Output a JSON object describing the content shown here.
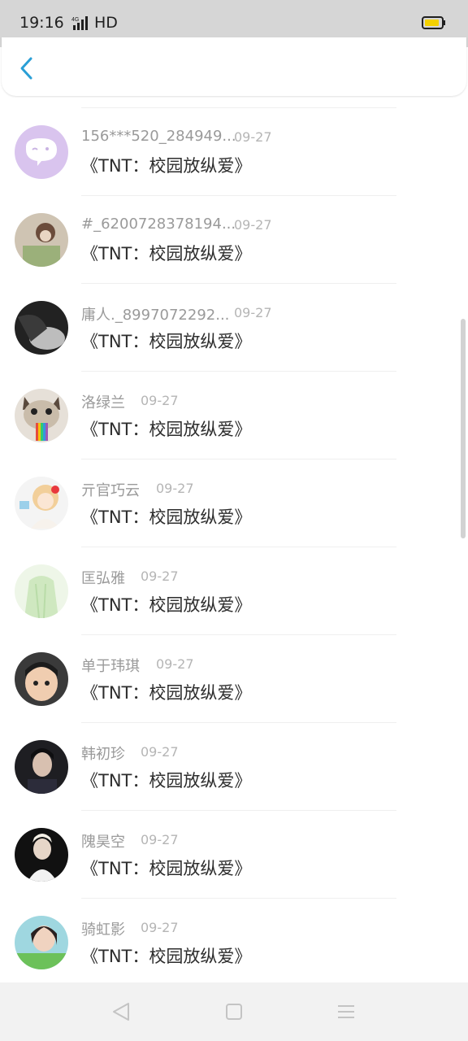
{
  "status": {
    "time": "19:16",
    "network": "4G",
    "hd": "HD",
    "accent": "#f4d100"
  },
  "header": {
    "back_icon": "chevron-left-icon",
    "accent": "#2a9fd6"
  },
  "list": {
    "items": [
      {
        "name": "156***520_284949...",
        "date": "09-27",
        "book": "《TNT：校园放纵爱》"
      },
      {
        "name": "#_6200728378194...",
        "date": "09-27",
        "book": "《TNT：校园放纵爱》"
      },
      {
        "name": "庸人._8997072292...",
        "date": "09-27",
        "book": "《TNT：校园放纵爱》"
      },
      {
        "name": "洛绿兰",
        "date": "09-27",
        "book": "《TNT：校园放纵爱》"
      },
      {
        "name": "亓官巧云",
        "date": "09-27",
        "book": "《TNT：校园放纵爱》"
      },
      {
        "name": "匡弘雅",
        "date": "09-27",
        "book": "《TNT：校园放纵爱》"
      },
      {
        "name": "单于玮琪",
        "date": "09-27",
        "book": "《TNT：校园放纵爱》"
      },
      {
        "name": "韩初珍",
        "date": "09-27",
        "book": "《TNT：校园放纵爱》"
      },
      {
        "name": "隗昊空",
        "date": "09-27",
        "book": "《TNT：校园放纵爱》"
      },
      {
        "name": "骑虹影",
        "date": "09-27",
        "book": "《TNT：校园放纵爱》"
      }
    ]
  },
  "nav": {
    "back": "triangle-back-icon",
    "home": "square-home-icon",
    "menu": "menu-lines-icon"
  }
}
